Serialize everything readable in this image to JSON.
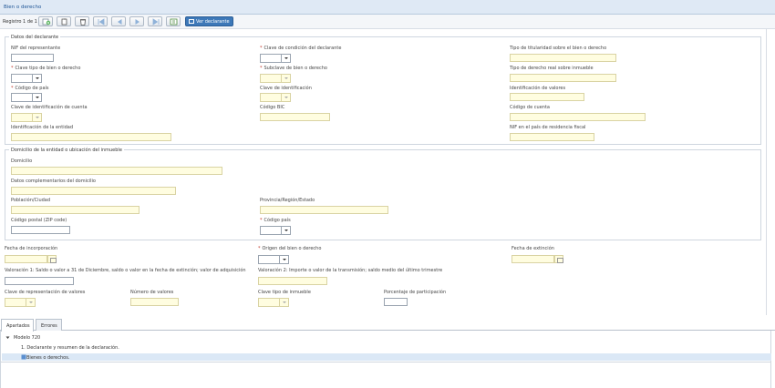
{
  "window": {
    "title": "Bien o derecho"
  },
  "toolbar": {
    "record_info": "Registro 1 de 1",
    "view_declarant": "Ver declarante"
  },
  "declarante": {
    "legend": "Datos del declarante",
    "nif_representante": "NIF del representante",
    "clave_condicion": "Clave de condición del declarante",
    "tipo_titularidad": "Tipo de titularidad sobre el bien o derecho",
    "clave_tipo_bien": "Clave tipo de bien o derecho",
    "subclave_bien": "Subclave de bien o derecho",
    "tipo_derecho_real": "Tipo de derecho real sobre inmueble",
    "codigo_pais": "Código de país",
    "clave_identificacion": "Clave de identificación",
    "identificacion_valores": "Identificación de valores",
    "clave_identificacion_cuenta": "Clave de identificación de cuenta",
    "codigo_bic": "Código BIC",
    "codigo_cuenta": "Código de cuenta",
    "identificacion_entidad": "Identificación de la entidad",
    "nif_pais_residencia": "NIF en el país de residencia fiscal"
  },
  "domicilio": {
    "legend": "Domicilio de la entidad o ubicación del inmueble",
    "domicilio": "Domicilio",
    "datos_complementarios": "Datos complementarios del domicilio",
    "poblacion": "Población/Ciudad",
    "provincia": "Provincia/Región/Estado",
    "codigo_postal": "Código postal (ZIP code)",
    "codigo_pais": "Código país"
  },
  "general": {
    "fecha_incorporacion": "Fecha de incorporación",
    "origen_bien": "Origen del bien o derecho",
    "fecha_extincion": "Fecha de extinción",
    "valoracion1": "Valoración 1: Saldo o valor a 31 de Diciembre, saldo o valor en la fecha de extinción; valor de adquisición",
    "valoracion2": "Valoración 2: Importe o valor de la transmisión; saldo medio del último trimestre",
    "clave_representacion": "Clave de representación de valores",
    "numero_valores": "Número de valores",
    "clave_tipo_inmueble": "Clave tipo de inmueble",
    "porcentaje": "Porcentaje de participación"
  },
  "tabs": [
    {
      "label": "Apartados"
    },
    {
      "label": "Errores"
    }
  ],
  "tree": {
    "root": "Modelo 720",
    "children": [
      {
        "label": "1. Declarante y resumen de la declaración."
      },
      {
        "label": "Bienes o derechos."
      }
    ]
  },
  "colors": {
    "accent": "#3d78b8",
    "title_bg": "#dfe9f5",
    "input_bg": "#fffde0",
    "required": "#c0392b"
  }
}
